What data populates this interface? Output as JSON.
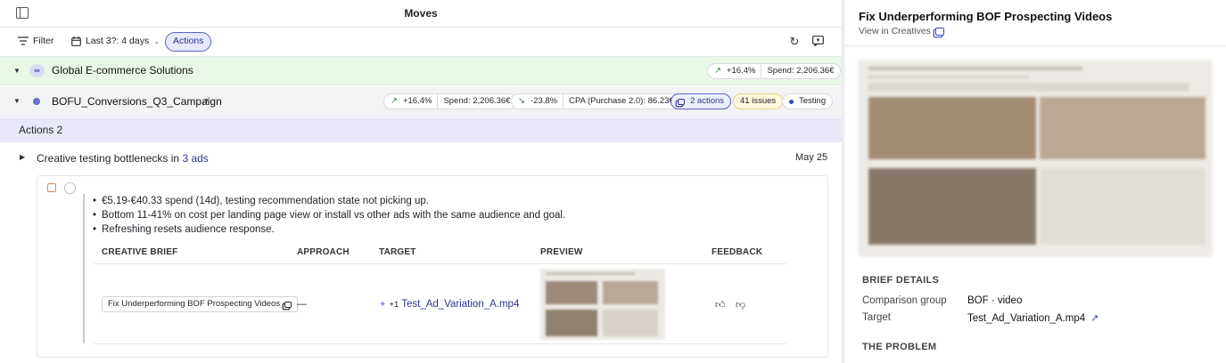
{
  "header": {
    "title": "Moves"
  },
  "toolbar": {
    "filter_label": "Filter",
    "date_label": "Last 3?: 4 days",
    "actions_label": "Actions"
  },
  "global_row": {
    "title": "Global E-commerce Solutions",
    "trend": "+16.4%",
    "spend": "Spend: 2,206.36€"
  },
  "campaign_row": {
    "title": "BOFU_Conversions_Q3_Campaign",
    "trend_up": "+16.4%",
    "spend": "Spend: 2,206.36€",
    "trend_down": "-23.8%",
    "cpa": "CPA (Purchase 2.0): 86.23€",
    "actions_count": "2 actions",
    "issues": "41 issues",
    "status": "Testing"
  },
  "actions_section": {
    "label": "Actions 2"
  },
  "bottleneck": {
    "text_prefix": "Creative testing bottlenecks in",
    "ads_link": "3 ads",
    "date": "May 25"
  },
  "card": {
    "bullets": [
      "€5.19-€40.33 spend (14d), testing recommendation state not picking up.",
      "Bottom 11-41% on cost per landing page view or install vs other ads with the same audience and goal.",
      "Refreshing resets audience response."
    ],
    "columns": [
      "CREATIVE BRIEF",
      "APPROACH",
      "TARGET",
      "PREVIEW",
      "FEEDBACK"
    ],
    "row": {
      "brief": "Fix Underperforming BOF Prospecting Videos",
      "approach": "—",
      "target_prefix": "+1",
      "target": "Test_Ad_Variation_A.mp4"
    }
  },
  "right_panel": {
    "title": "Fix Underperforming BOF Prospecting Videos",
    "view_link": "View in Creatives",
    "brief_details_heading": "BRIEF DETAILS",
    "comparison_label": "Comparison group",
    "comparison_value": "BOF · video",
    "target_label": "Target",
    "target_value": "Test_Ad_Variation_A.mp4",
    "problem_heading": "THE PROBLEM"
  },
  "colors": {
    "accent": "#5a62c8",
    "global_bg": "#e9f8e6",
    "actions_bg": "#e8e8f8",
    "link": "#2f358f"
  }
}
